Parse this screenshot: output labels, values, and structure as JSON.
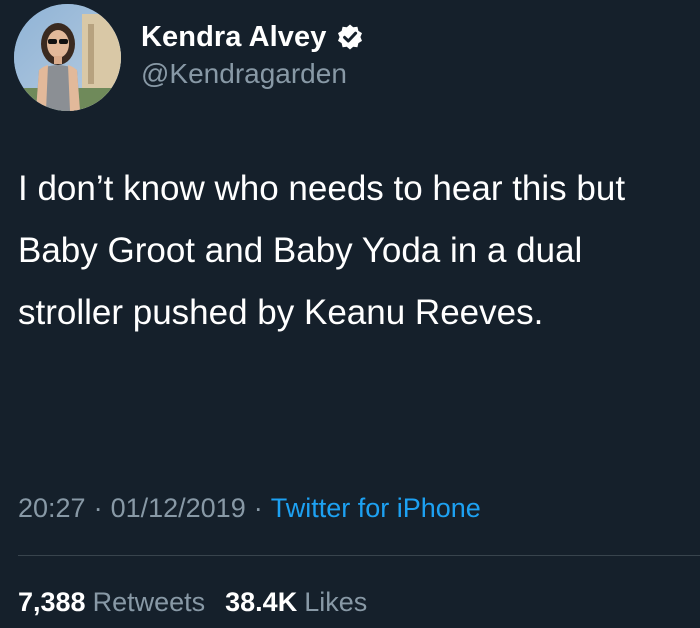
{
  "author": {
    "display_name": "Kendra Alvey",
    "handle": "@Kendragarden",
    "verified": true,
    "avatar": "profile-photo-avatar"
  },
  "tweet": {
    "text": "I don’t know who needs to hear this but Baby Groot and Baby Yoda in a dual stroller pushed by Keanu Reeves.",
    "time": "20:27",
    "separator": "·",
    "date": "01/12/2019",
    "source": "Twitter for iPhone"
  },
  "stats": {
    "retweets_count": "7,388",
    "retweets_label": "Retweets",
    "likes_count": "38.4K",
    "likes_label": "Likes"
  },
  "colors": {
    "background": "#15202b",
    "text_primary": "#ffffff",
    "text_secondary": "#8899a6",
    "link": "#1da1f2",
    "divider": "#38444d"
  },
  "icons": {
    "verified": "verified-badge-icon"
  }
}
